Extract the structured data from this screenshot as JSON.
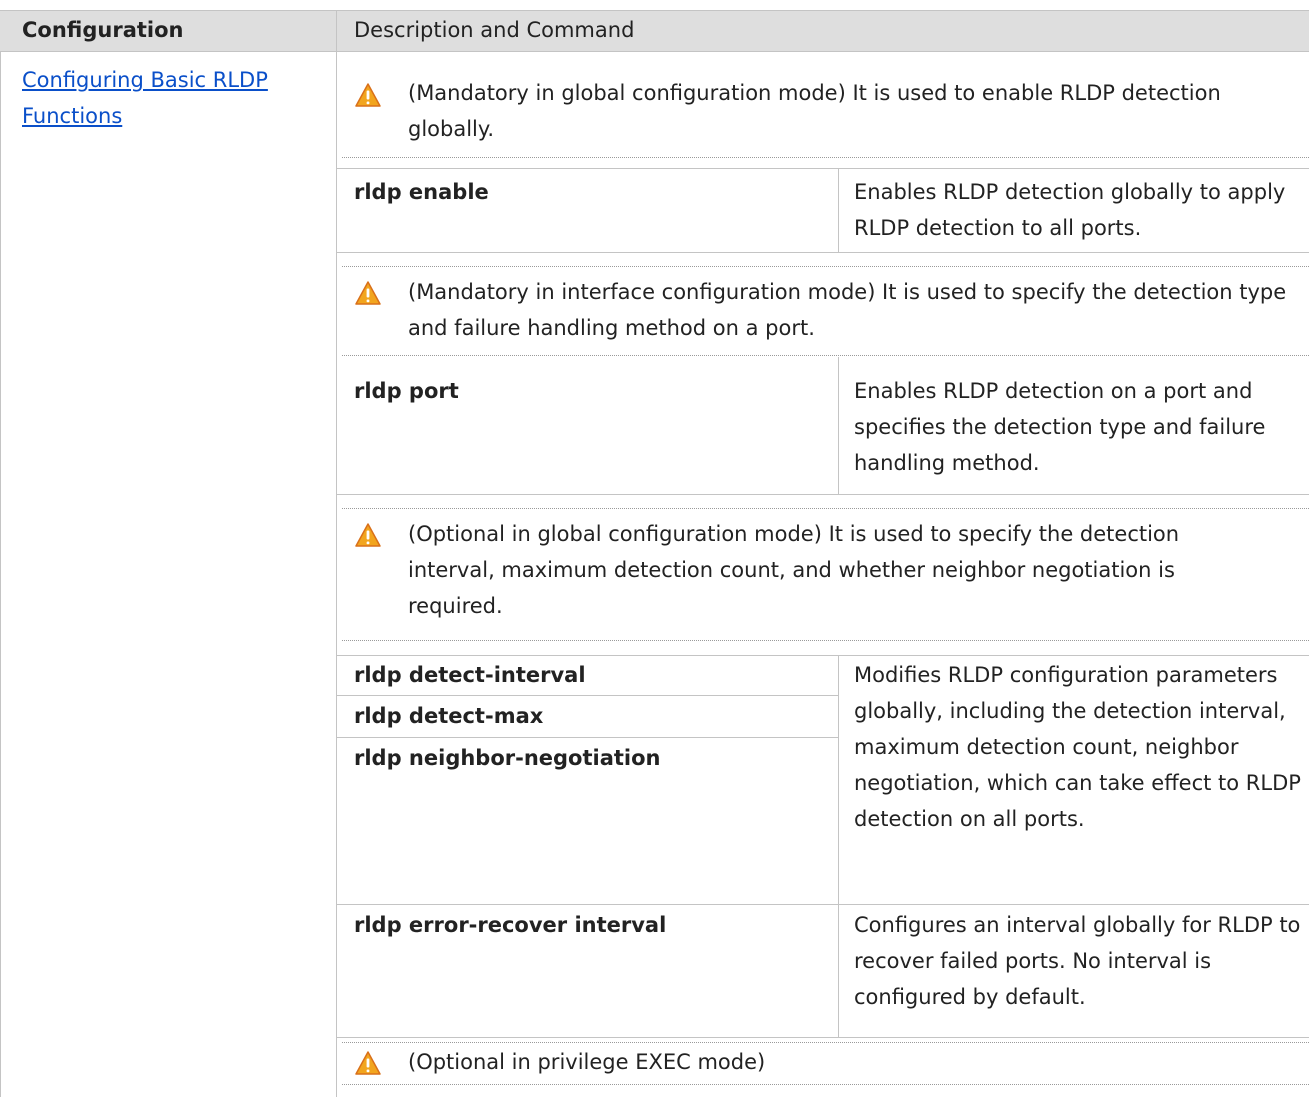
{
  "header": {
    "col1": "Configuration",
    "col2": "Description and Command"
  },
  "section": {
    "link_text": "Configuring Basic RLDP Functions"
  },
  "notes": [
    "(Mandatory in global configuration mode) It is used to enable RLDP detection globally.",
    "(Mandatory in interface configuration mode) It is used to specify the detection type and failure handling method on a port.",
    "(Optional in global configuration mode) It is used to specify the detection interval, maximum detection count, and whether neighbor negotiation is required.",
    "(Optional in privilege EXEC mode)"
  ],
  "commands": {
    "rldp_enable": "rldp enable",
    "rldp_port": "rldp port",
    "rldp_detect_interval": "rldp detect-interval",
    "rldp_detect_max": "rldp detect-max",
    "rldp_neighbor_negotiation": "rldp neighbor-negotiation",
    "rldp_error_recover": "rldp error-recover interval"
  },
  "descriptions": {
    "rldp_enable": "Enables RLDP detection globally to apply RLDP detection to all ports.",
    "rldp_port": "Enables RLDP detection on a port and specifies the detection type and failure handling method.",
    "rldp_params": "Modifies RLDP configuration parameters globally, including the detection interval, maximum detection count, neighbor negotiation, which can take effect to RLDP detection on all ports.",
    "rldp_error_recover": "Configures an interval globally for RLDP to recover failed ports. No interval is configured by default."
  },
  "icons": {
    "warning": "warning-icon"
  },
  "colors": {
    "header_bg": "#dedede",
    "link": "#0a4fc9",
    "warning_fill": "#f2a51e",
    "warning_stroke": "#d9701a"
  }
}
